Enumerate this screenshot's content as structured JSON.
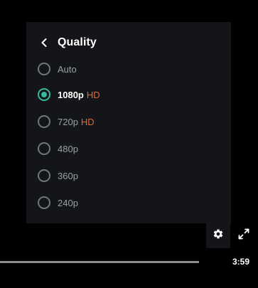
{
  "menu": {
    "title": "Quality",
    "options": [
      {
        "label": "Auto",
        "badge": "",
        "selected": false
      },
      {
        "label": "1080p",
        "badge": "HD",
        "selected": true
      },
      {
        "label": "720p",
        "badge": "HD",
        "selected": false
      },
      {
        "label": "480p",
        "badge": "",
        "selected": false
      },
      {
        "label": "360p",
        "badge": "",
        "selected": false
      },
      {
        "label": "240p",
        "badge": "",
        "selected": false
      }
    ]
  },
  "player": {
    "time": "3:59",
    "progress": 1.0
  },
  "icons": {
    "back": "chevron-left-icon",
    "settings": "gear-icon",
    "fullscreen": "fullscreen-icon"
  },
  "colors": {
    "menu_bg": "#141518",
    "accent": "#35b89c",
    "hd_badge": "#e5662e",
    "radio_border": "#6e7680",
    "option_text": "#9aa0a6"
  }
}
